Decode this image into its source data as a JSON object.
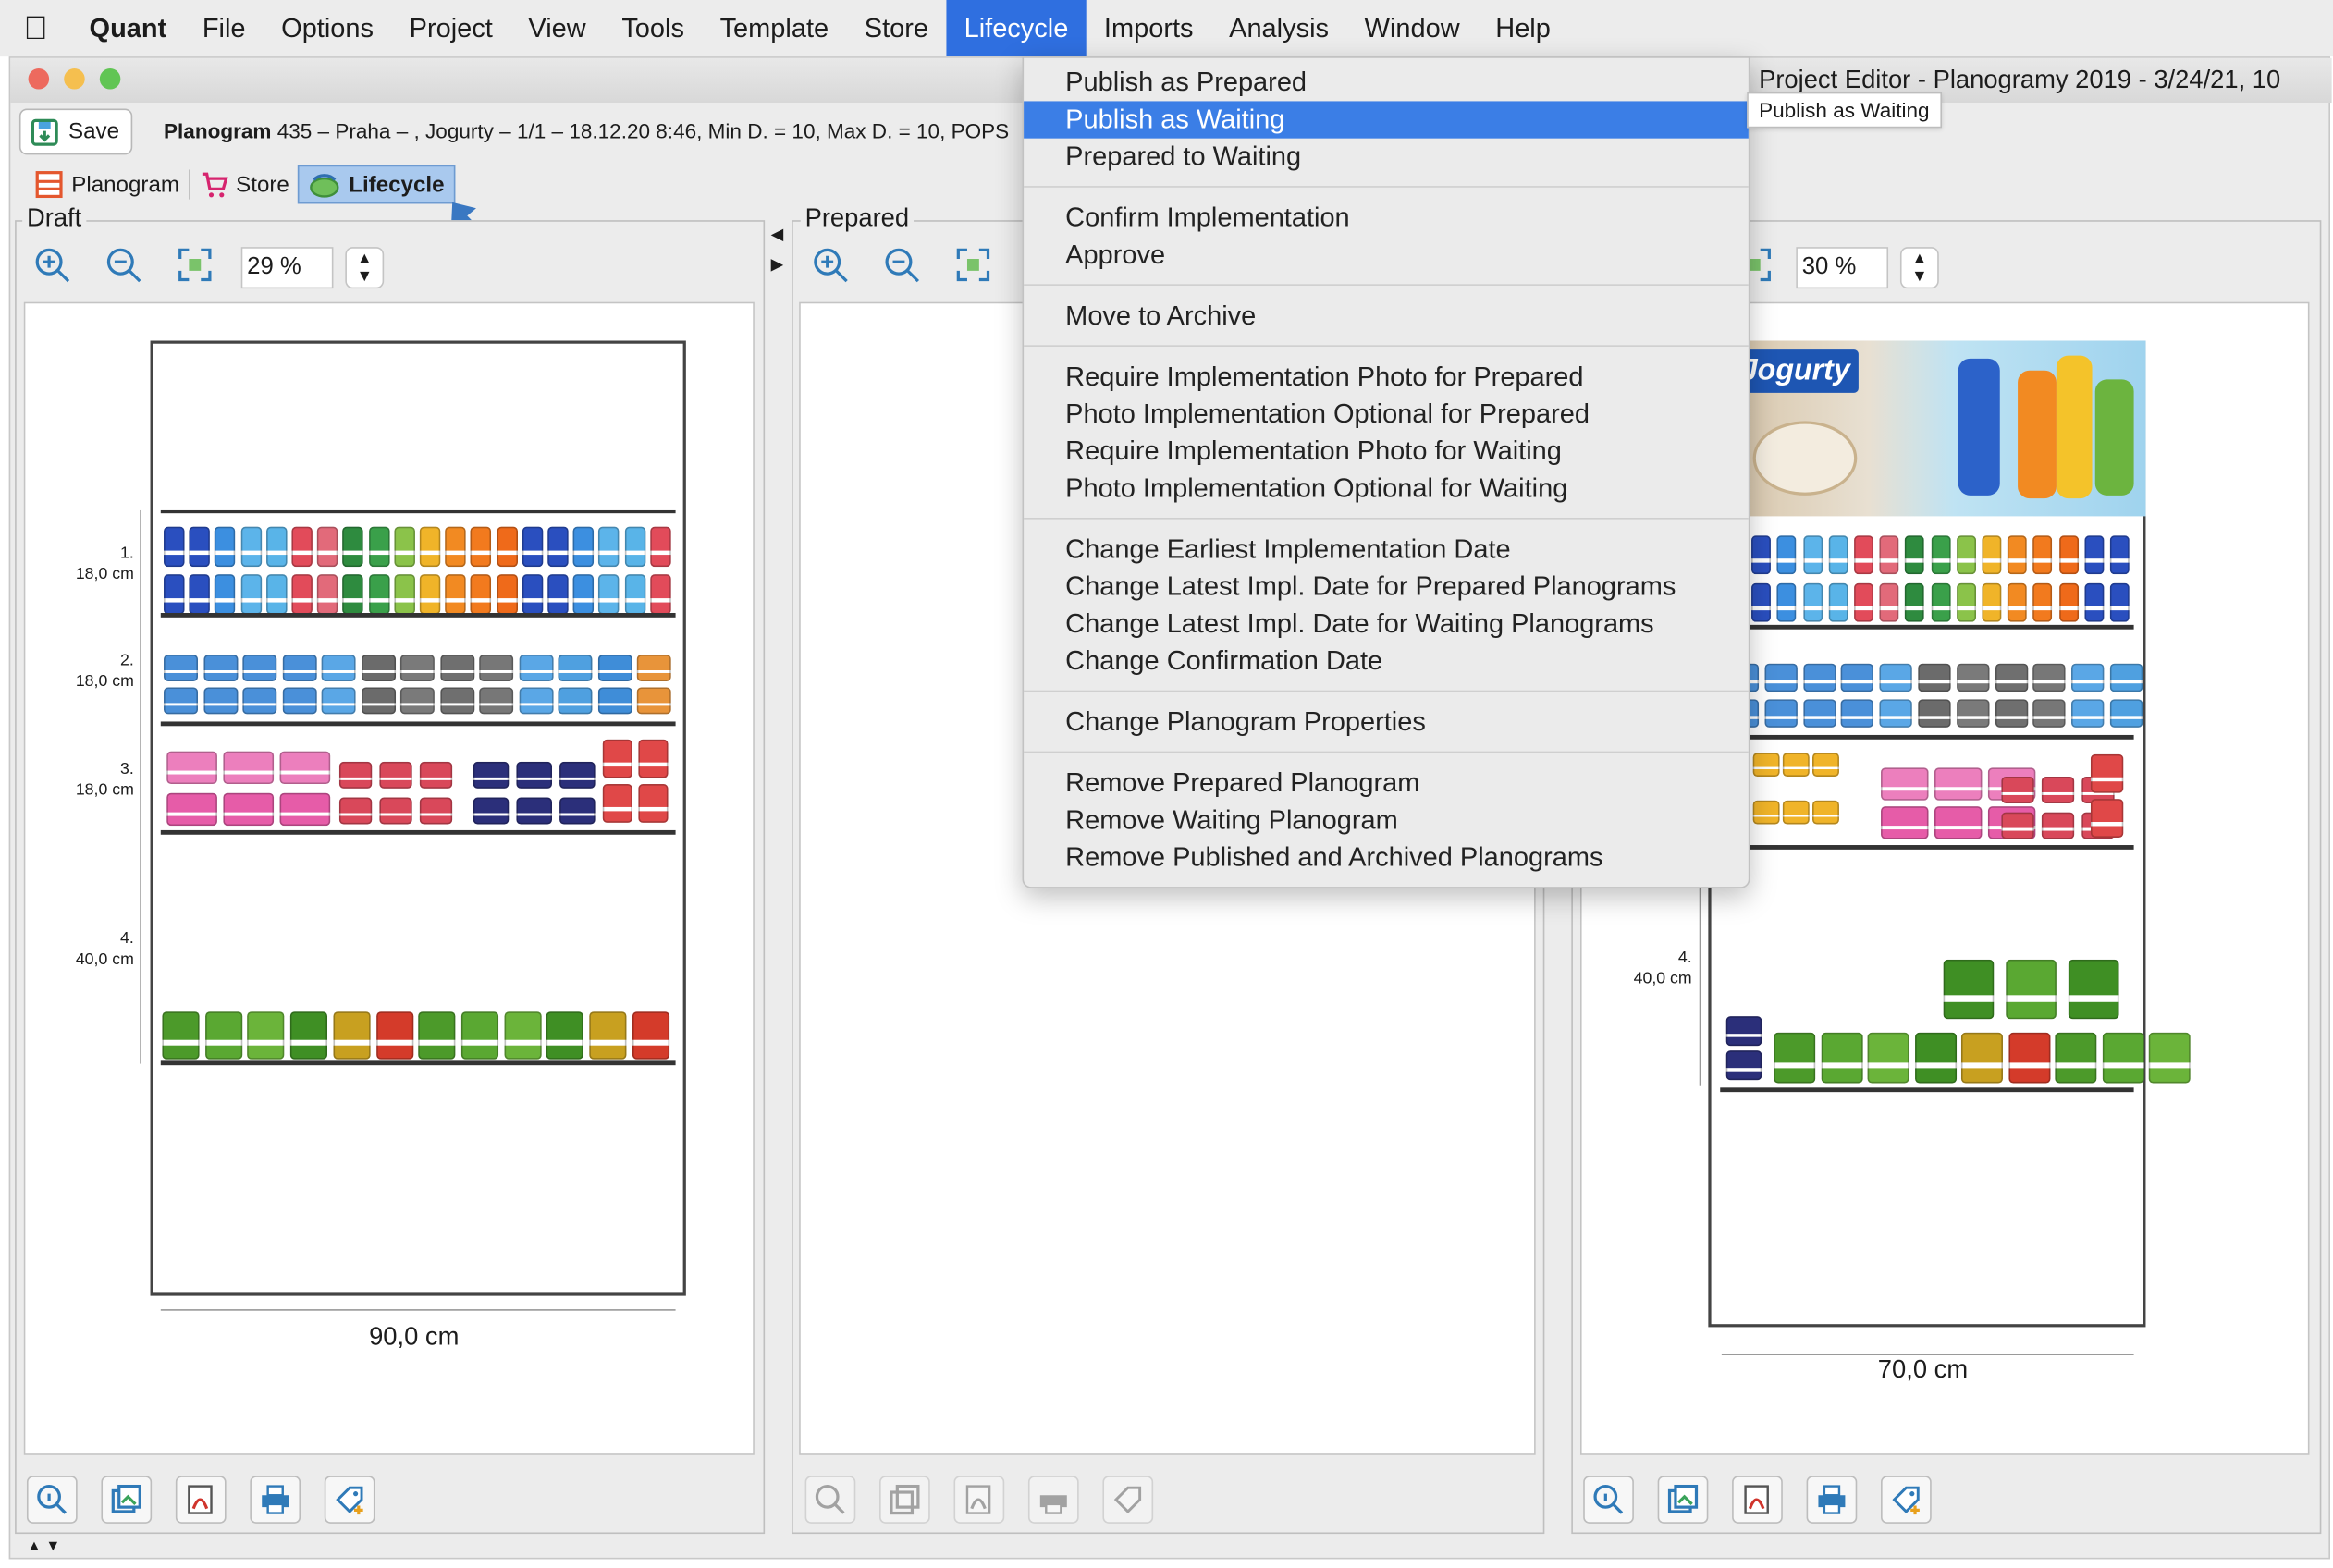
{
  "menubar": {
    "app_name": "Quant",
    "items": [
      "File",
      "Options",
      "Project",
      "View",
      "Tools",
      "Template",
      "Store",
      "Lifecycle",
      "Imports",
      "Analysis",
      "Window",
      "Help"
    ],
    "active_item": "Lifecycle"
  },
  "window": {
    "title": "Project Editor - Planogramy 2019 - 3/24/21, 10",
    "tooltip": "Publish as Waiting",
    "save_label": "Save",
    "info_text_bold": "Planogram",
    "info_text": " 435 – Praha – , Jogurty – 1/1 – 18.12.20 8:46, Min D. = 10, Max D. = 10, POPS"
  },
  "tabs": [
    {
      "label": "Planogram",
      "icon": "planogram-icon"
    },
    {
      "label": "Store",
      "icon": "cart-icon"
    },
    {
      "label": "Lifecycle",
      "icon": "lifecycle-icon",
      "selected": true
    }
  ],
  "panels": {
    "draft": {
      "label": "Draft",
      "zoom": "29 %",
      "width_label": "90,0 cm",
      "shelves": [
        {
          "num": "1.",
          "height": "18,0 cm"
        },
        {
          "num": "2.",
          "height": "18,0 cm"
        },
        {
          "num": "3.",
          "height": "18,0 cm"
        },
        {
          "num": "4.",
          "height": "40,0 cm"
        }
      ]
    },
    "prepared": {
      "label": "Prepared"
    },
    "waiting": {
      "zoom": "30 %",
      "width_label": "70,0 cm",
      "shelf4_num": "4.",
      "shelf4_height": "40,0 cm",
      "header_brand": "Jogurty"
    }
  },
  "lifecycle_menu": {
    "groups": [
      [
        "Publish as Prepared",
        "Publish as Waiting",
        "Prepared to Waiting"
      ],
      [
        "Confirm Implementation",
        "Approve"
      ],
      [
        "Move to Archive"
      ],
      [
        "Require Implementation Photo for Prepared",
        "Photo Implementation Optional for Prepared",
        "Require Implementation Photo for Waiting",
        "Photo Implementation Optional for Waiting"
      ],
      [
        "Change Earliest Implementation Date",
        "Change Latest Impl. Date for Prepared Planograms",
        "Change Latest Impl. Date for Waiting Planograms",
        "Change Confirmation Date"
      ],
      [
        "Change Planogram Properties"
      ],
      [
        "Remove Prepared Planogram",
        "Remove Waiting Planogram",
        "Remove Published and Archived Planograms"
      ]
    ],
    "highlighted": "Publish as Waiting"
  },
  "colors": {
    "menu_highlight": "#3b7ee6",
    "accent": "#2f6fe0",
    "tab_selected": "#a9c9ee"
  }
}
